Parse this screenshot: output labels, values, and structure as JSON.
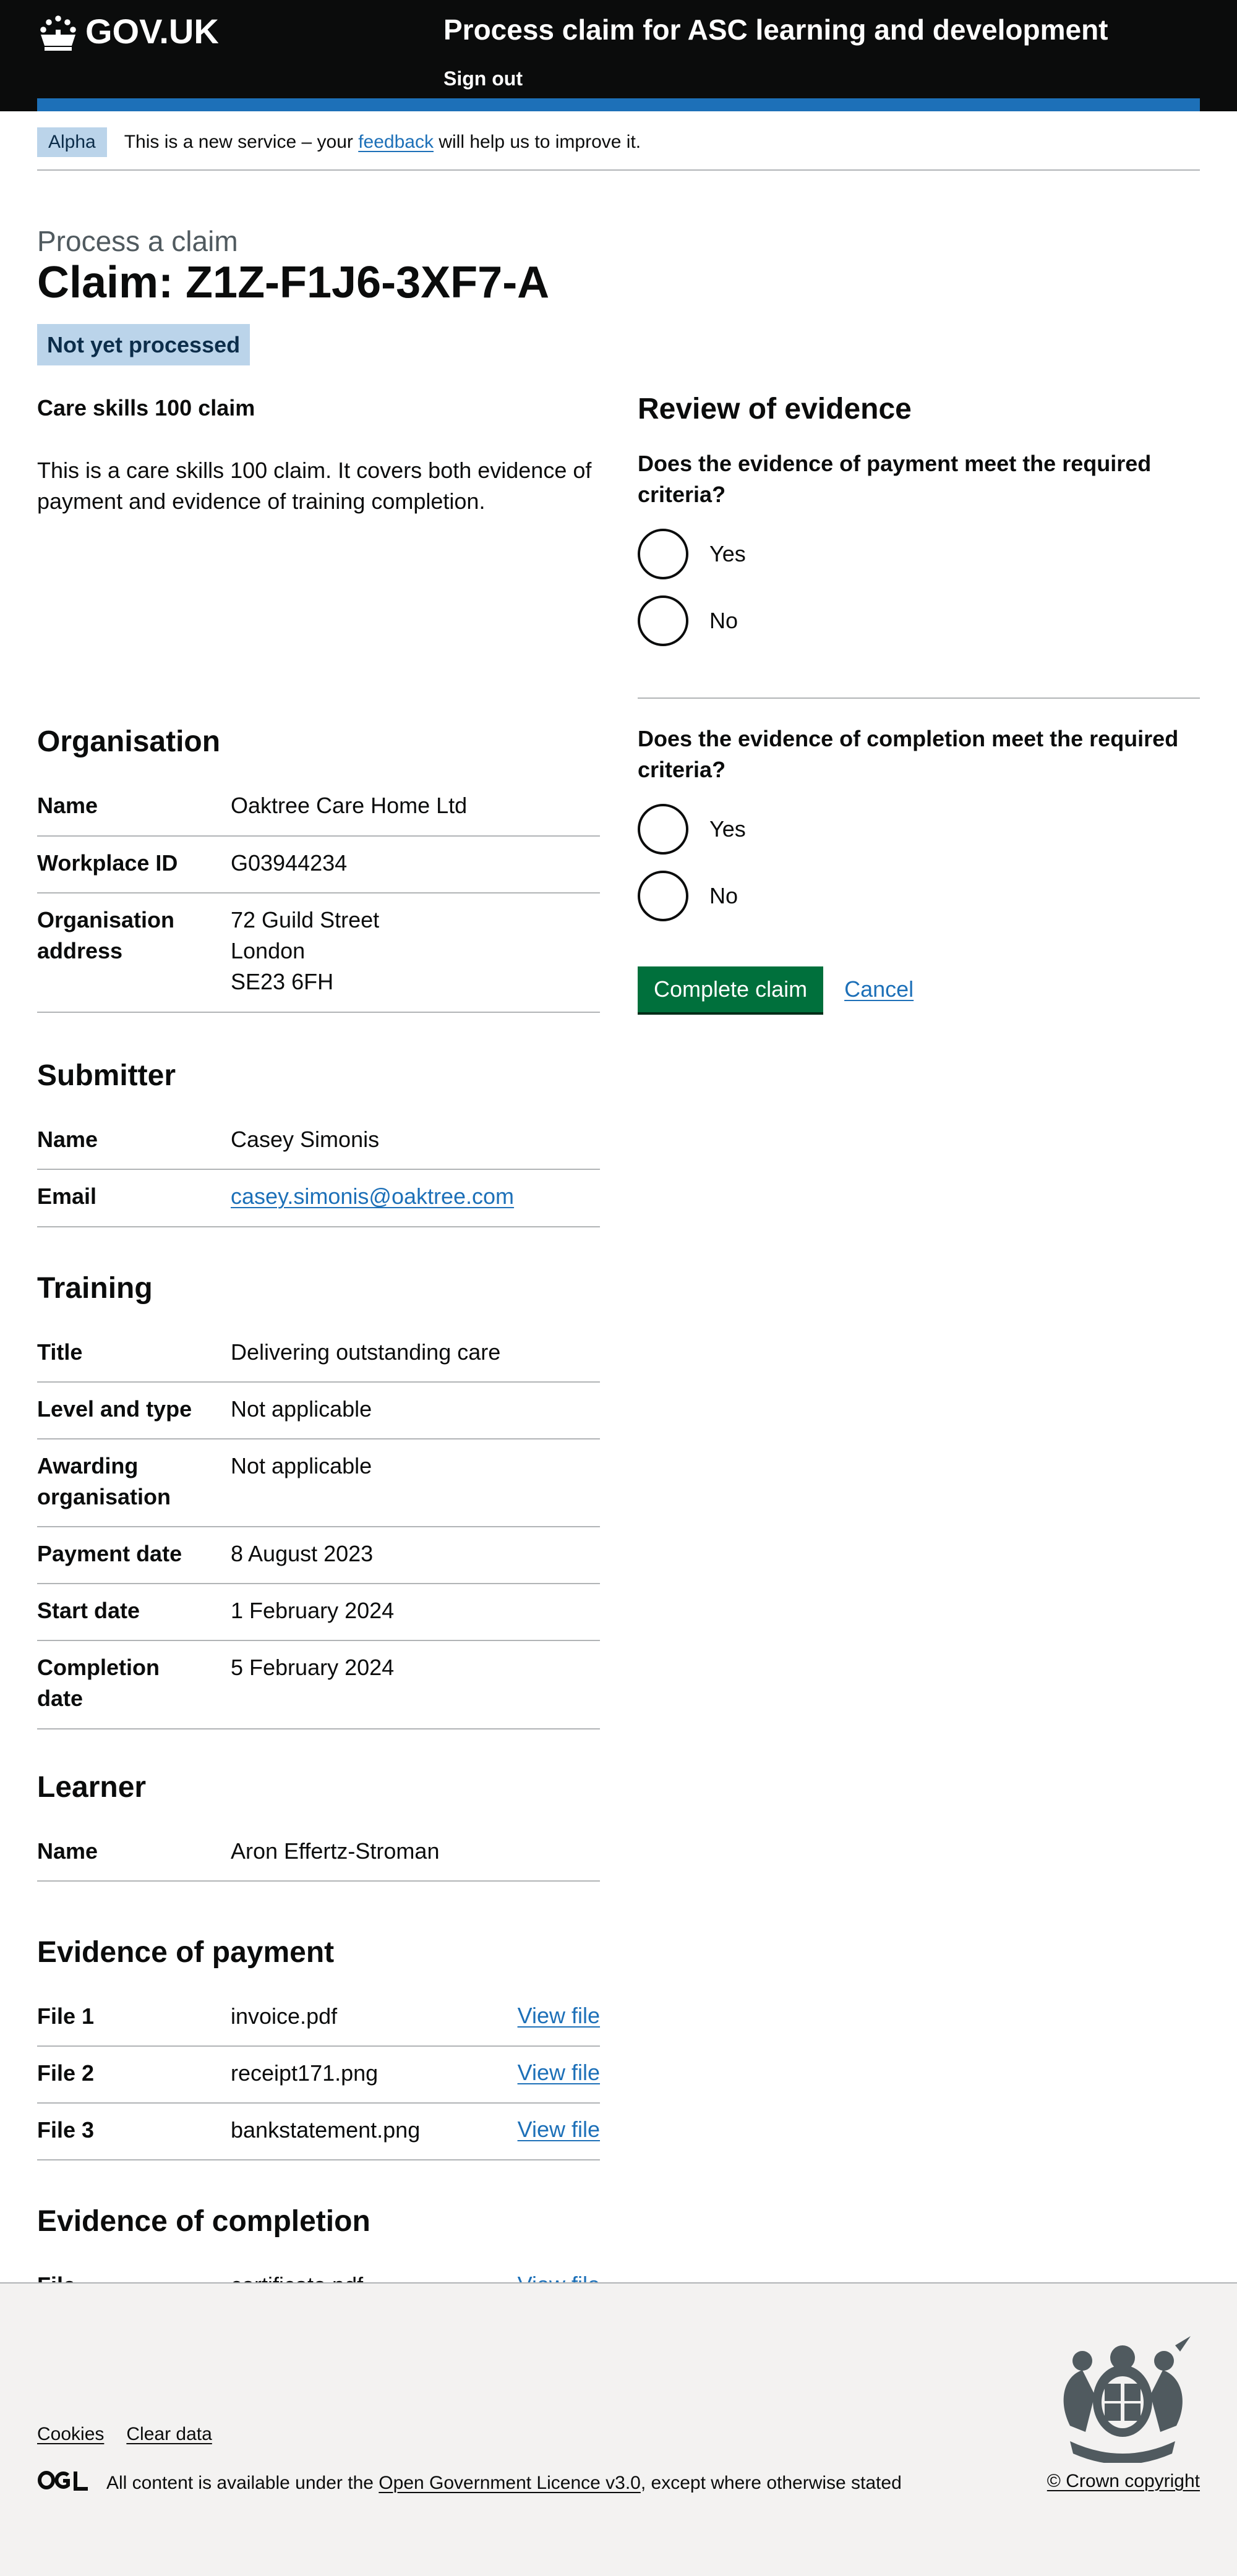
{
  "header": {
    "logo_text": "GOV.UK",
    "service_name": "Process claim for ASC learning and development",
    "sign_out": "Sign out"
  },
  "phase_banner": {
    "tag": "Alpha",
    "text_before": "This is a new service – your",
    "link": "feedback",
    "text_after": "will help us to improve it."
  },
  "page": {
    "caption": "Process a claim",
    "title": "Claim: Z1Z-F1J6-3XF7-A",
    "status": "Not yet processed",
    "claim_type": "Care skills 100 claim",
    "description": "This is a care skills 100 claim. It covers both evidence of payment and evidence of training completion."
  },
  "organisation": {
    "heading": "Organisation",
    "rows": [
      {
        "key": "Name",
        "value": "Oaktree Care Home Ltd"
      },
      {
        "key": "Workplace ID",
        "value": "G03944234"
      },
      {
        "key": "Organisation address",
        "lines": [
          "72 Guild Street",
          "London",
          "SE23 6FH"
        ]
      }
    ]
  },
  "submitter": {
    "heading": "Submitter",
    "rows": [
      {
        "key": "Name",
        "value": "Casey Simonis"
      },
      {
        "key": "Email",
        "value": "casey.simonis@oaktree.com"
      }
    ]
  },
  "training": {
    "heading": "Training",
    "rows": [
      {
        "key": "Title",
        "value": "Delivering outstanding care"
      },
      {
        "key": "Level and type",
        "value": "Not applicable"
      },
      {
        "key": "Awarding organisation",
        "value": "Not applicable"
      },
      {
        "key": "Payment date",
        "value": "8 August 2023"
      },
      {
        "key": "Start date",
        "value": "1 February 2024"
      },
      {
        "key": "Completion date",
        "value": "5 February 2024"
      }
    ]
  },
  "learner": {
    "heading": "Learner",
    "rows": [
      {
        "key": "Name",
        "value": "Aron Effertz-Stroman"
      }
    ]
  },
  "evidence_payment": {
    "heading": "Evidence of payment",
    "rows": [
      {
        "key": "File 1",
        "value": "invoice.pdf",
        "action": "View file"
      },
      {
        "key": "File 2",
        "value": "receipt171.png",
        "action": "View file"
      },
      {
        "key": "File 3",
        "value": "bankstatement.png",
        "action": "View file"
      }
    ]
  },
  "evidence_completion": {
    "heading": "Evidence of completion",
    "rows": [
      {
        "key": "File",
        "value": "certificate.pdf",
        "action": "View file"
      }
    ]
  },
  "review": {
    "heading": "Review of evidence",
    "q1": {
      "question": "Does the evidence of payment meet the required criteria?",
      "yes": "Yes",
      "no": "No"
    },
    "q2": {
      "question": "Does the evidence of completion meet the required criteria?",
      "yes": "Yes",
      "no": "No"
    },
    "submit": "Complete claim",
    "cancel": "Cancel"
  },
  "footer": {
    "links": [
      "Cookies",
      "Clear data"
    ],
    "licence_before": "All content is available under the",
    "licence_link": "Open Government Licence v3.0",
    "licence_after": ", except where otherwise stated",
    "copyright": "© Crown copyright"
  },
  "colors": {
    "header_bg": "#0b0c0c",
    "brand_blue": "#1d70b8",
    "tag_bg": "#bbd4ea",
    "button_green": "#00703c",
    "footer_bg": "#f3f2f1"
  }
}
